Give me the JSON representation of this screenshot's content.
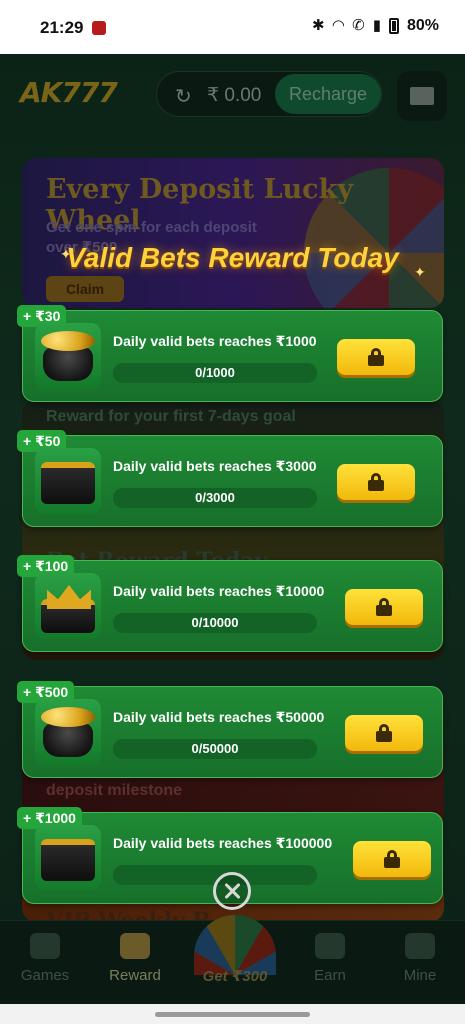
{
  "status_bar": {
    "time": "21:29",
    "battery": "80%"
  },
  "header": {
    "logo": "AK777",
    "balance": "₹ 0.00",
    "recharge_label": "Recharge"
  },
  "background_banners": {
    "wheel_title": "Every Deposit Lucky Wheel",
    "wheel_subtitle": "Get one spin for each deposit over ₹500",
    "wheel_claim": "Claim",
    "goal_text": "Reward for your first 7-days goal",
    "bet_text": "Bet Reward Today",
    "deposit_text": "deposit milestone",
    "vip_text": "VIP Weekly R"
  },
  "modal": {
    "title": "Valid Bets Reward Today",
    "rewards": [
      {
        "badge": "+ ₹30",
        "description": "Daily valid bets reaches ₹1000",
        "progress_text": "0/1000",
        "progress": 0,
        "thumb": "pot-of-gold"
      },
      {
        "badge": "+ ₹50",
        "description": "Daily valid bets reaches ₹3000",
        "progress_text": "0/3000",
        "progress": 0,
        "thumb": "treasure-box"
      },
      {
        "badge": "+ ₹100",
        "description": "Daily valid bets reaches ₹10000",
        "progress_text": "0/10000",
        "progress": 0,
        "thumb": "crown"
      },
      {
        "badge": "+ ₹500",
        "description": "Daily valid bets reaches ₹50000",
        "progress_text": "0/50000",
        "progress": 0,
        "thumb": "pot-of-gold"
      },
      {
        "badge": "+ ₹1000",
        "description": "Daily valid bets reaches ₹100000",
        "progress_text": "",
        "progress": 0,
        "thumb": "treasure-box"
      }
    ]
  },
  "bottom_nav": {
    "games": "Games",
    "reward": "Reward",
    "center": "Get ₹300",
    "earn": "Earn",
    "mine": "Mine"
  }
}
